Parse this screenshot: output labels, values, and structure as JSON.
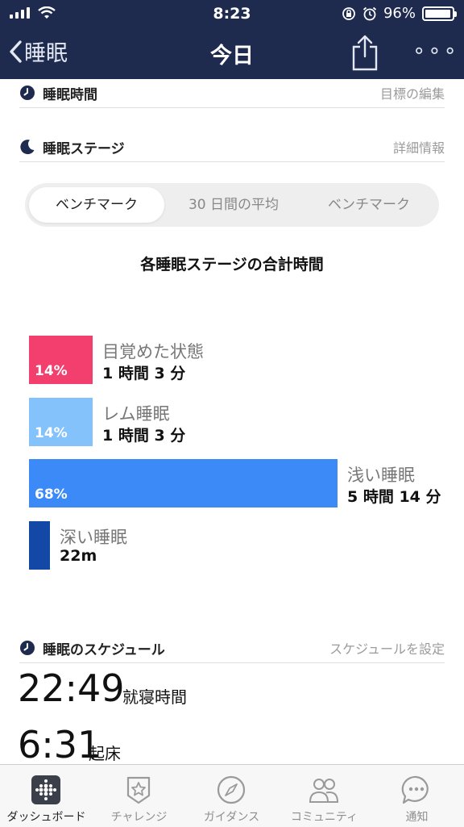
{
  "status_bar": {
    "time": "8:23",
    "battery": "96%",
    "battery_level": 0.96
  },
  "nav": {
    "back_label": "睡眠",
    "title": "今日"
  },
  "section_sleep_time": {
    "label": "睡眠時間",
    "link": "目標の編集"
  },
  "section_stages": {
    "label": "睡眠ステージ",
    "link": "詳細情報"
  },
  "segments": [
    "ベンチマーク",
    "30 日間の平均",
    "ベンチマーク"
  ],
  "chart_title": "各睡眠ステージの合計時間",
  "chart_data": {
    "type": "bar",
    "title": "各睡眠ステージの合計時間",
    "categories": [
      "目覚めた状態",
      "レム睡眠",
      "浅い睡眠",
      "深い睡眠"
    ],
    "percent_labels": [
      "14%",
      "14%",
      "68%",
      ""
    ],
    "values": [
      14,
      14,
      68,
      4
    ],
    "durations": [
      "1 時間 3 分",
      "1 時間 3 分",
      "5 時間 14 分",
      "22m"
    ],
    "colors": [
      "#f23f6e",
      "#84c2fb",
      "#3b8af7",
      "#1448a6"
    ]
  },
  "section_schedule": {
    "label": "睡眠のスケジュール",
    "link": "スケジュールを設定"
  },
  "schedule": [
    {
      "time": "22:49",
      "label": "就寝時間"
    },
    {
      "time": "6:31",
      "label": "起床"
    }
  ],
  "tabs": [
    "ダッシュボード",
    "チャレンジ",
    "ガイダンス",
    "コミュニティ",
    "通知"
  ]
}
